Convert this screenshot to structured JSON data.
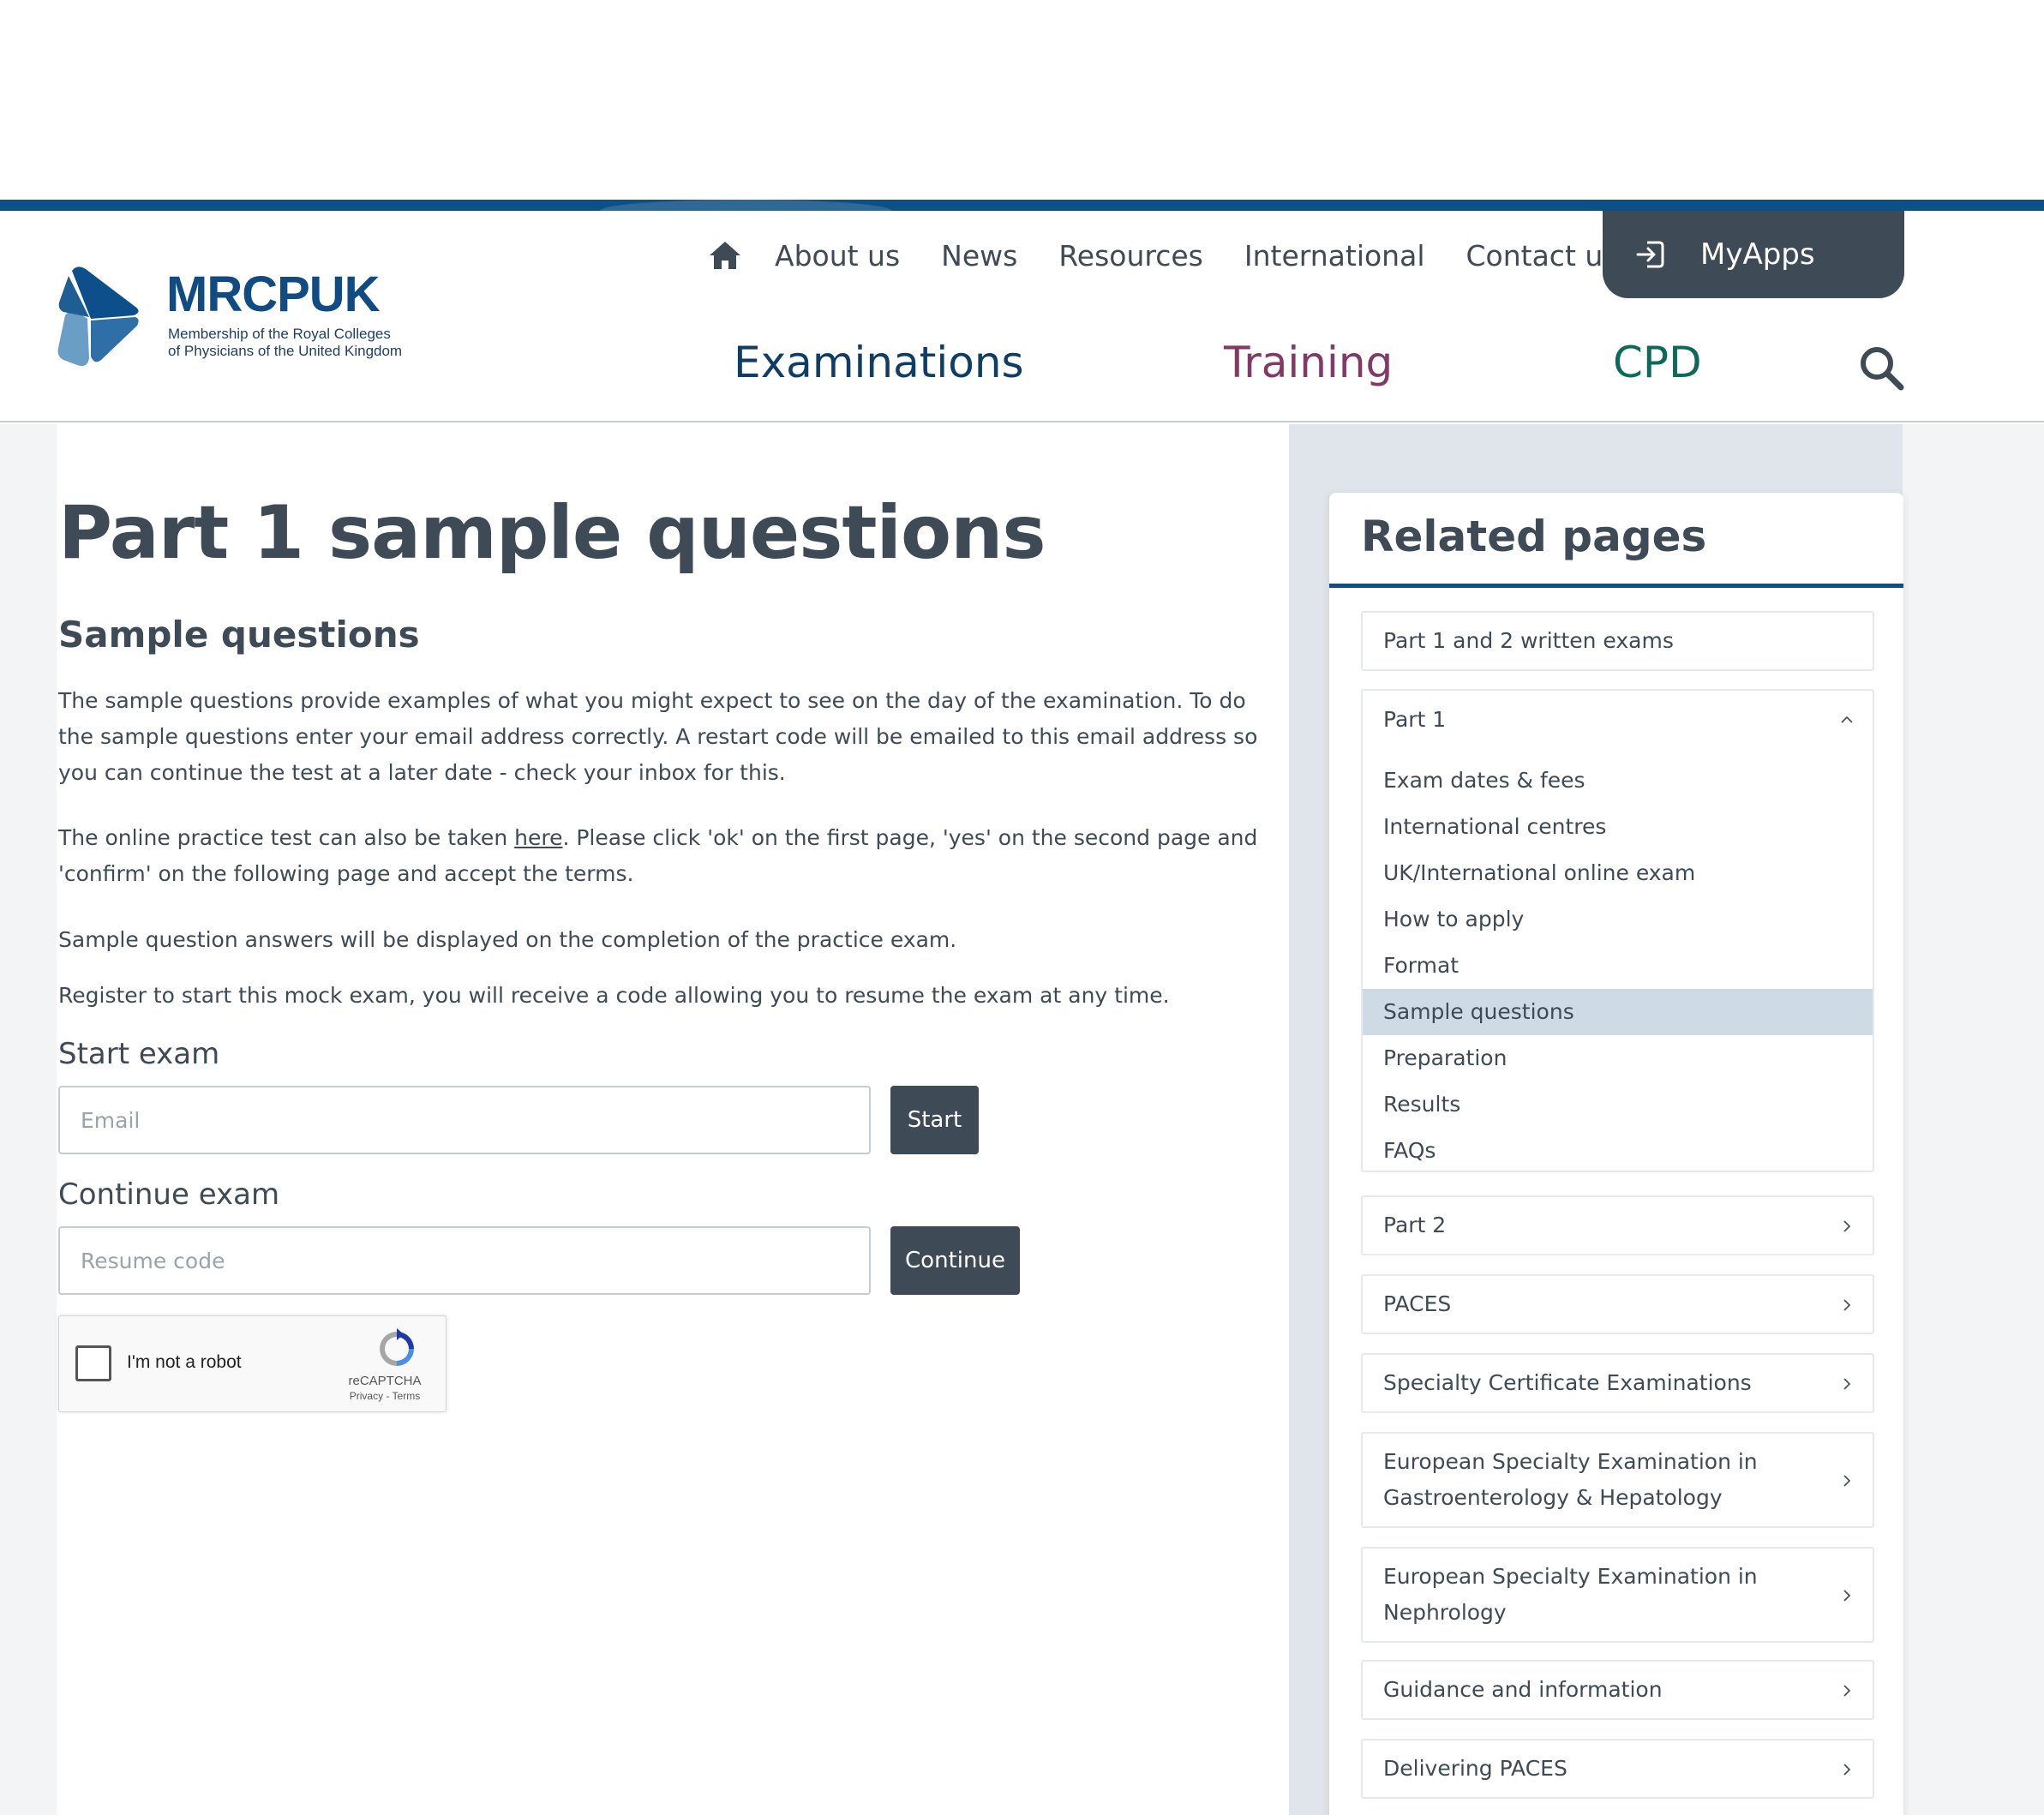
{
  "header": {
    "logo": {
      "wordmark": "MRCPUK",
      "subtitle_line1": "Membership of the Royal Colleges",
      "subtitle_line2": "of Physicians of the United Kingdom"
    },
    "home_icon": "home-icon",
    "util_nav": [
      "About us",
      "News",
      "Resources",
      "International",
      "Contact us"
    ],
    "myapps": {
      "label": "MyApps",
      "icon": "sign-in-icon"
    },
    "main_nav": [
      {
        "label": "Examinations",
        "color": "#0f3d66"
      },
      {
        "label": "Training",
        "color": "#803a65"
      },
      {
        "label": "CPD",
        "color": "#0d6a5a"
      }
    ],
    "search_icon": "search-icon",
    "brand_color": "#0b5187"
  },
  "main": {
    "title": "Part 1 sample questions",
    "section_title": "Sample questions",
    "paragraph1": "The sample questions provide examples of what you might expect to see on the day of the examination. To do the sample questions enter your email address correctly. A restart code will be emailed to this email address so you can continue the test at a later date - check your inbox for this.",
    "paragraph2_before": "The online practice test can also be taken ",
    "paragraph2_link": "here",
    "paragraph2_after": ". Please click 'ok' on the first page, 'yes' on the second page and 'confirm' on the following page and accept the terms.",
    "paragraph3": "Sample question answers will be displayed on the completion of the practice exam.",
    "paragraph4": "Register to start this mock exam, you will receive a code allowing you to resume the exam at any time.",
    "start_exam": {
      "label": "Start exam",
      "placeholder": "Email",
      "value": "",
      "button": "Start"
    },
    "continue_exam": {
      "label": "Continue exam",
      "placeholder": "Resume code",
      "value": "",
      "button": "Continue"
    },
    "recaptcha": {
      "label": "I'm not a robot",
      "brand": "reCAPTCHA",
      "links": "Privacy - Terms",
      "checked": false
    }
  },
  "sidebar": {
    "title": "Related pages",
    "items": [
      {
        "label": "Part 1 and 2 written exams",
        "chevron": "none"
      },
      {
        "label": "Part 1",
        "chevron": "chevron-up-icon",
        "expanded": true,
        "children": [
          {
            "label": "Exam dates & fees",
            "active": false
          },
          {
            "label": "International centres",
            "active": false
          },
          {
            "label": "UK/International online exam",
            "active": false
          },
          {
            "label": "How to apply",
            "active": false
          },
          {
            "label": "Format",
            "active": false
          },
          {
            "label": "Sample questions",
            "active": true
          },
          {
            "label": "Preparation",
            "active": false
          },
          {
            "label": "Results",
            "active": false
          },
          {
            "label": "FAQs",
            "active": false
          }
        ]
      },
      {
        "label": "Part 2",
        "chevron": "chevron-right-icon"
      },
      {
        "label": "PACES",
        "chevron": "chevron-right-icon"
      },
      {
        "label": "Specialty Certificate Examinations",
        "chevron": "chevron-right-icon"
      },
      {
        "label": "European Specialty Examination in Gastroenterology & Hepatology",
        "chevron": "chevron-right-icon"
      },
      {
        "label": "European Specialty Examination in Nephrology",
        "chevron": "chevron-right-icon"
      },
      {
        "label": "Guidance and information",
        "chevron": "chevron-right-icon"
      },
      {
        "label": "Delivering PACES",
        "chevron": "chevron-right-icon"
      }
    ]
  }
}
